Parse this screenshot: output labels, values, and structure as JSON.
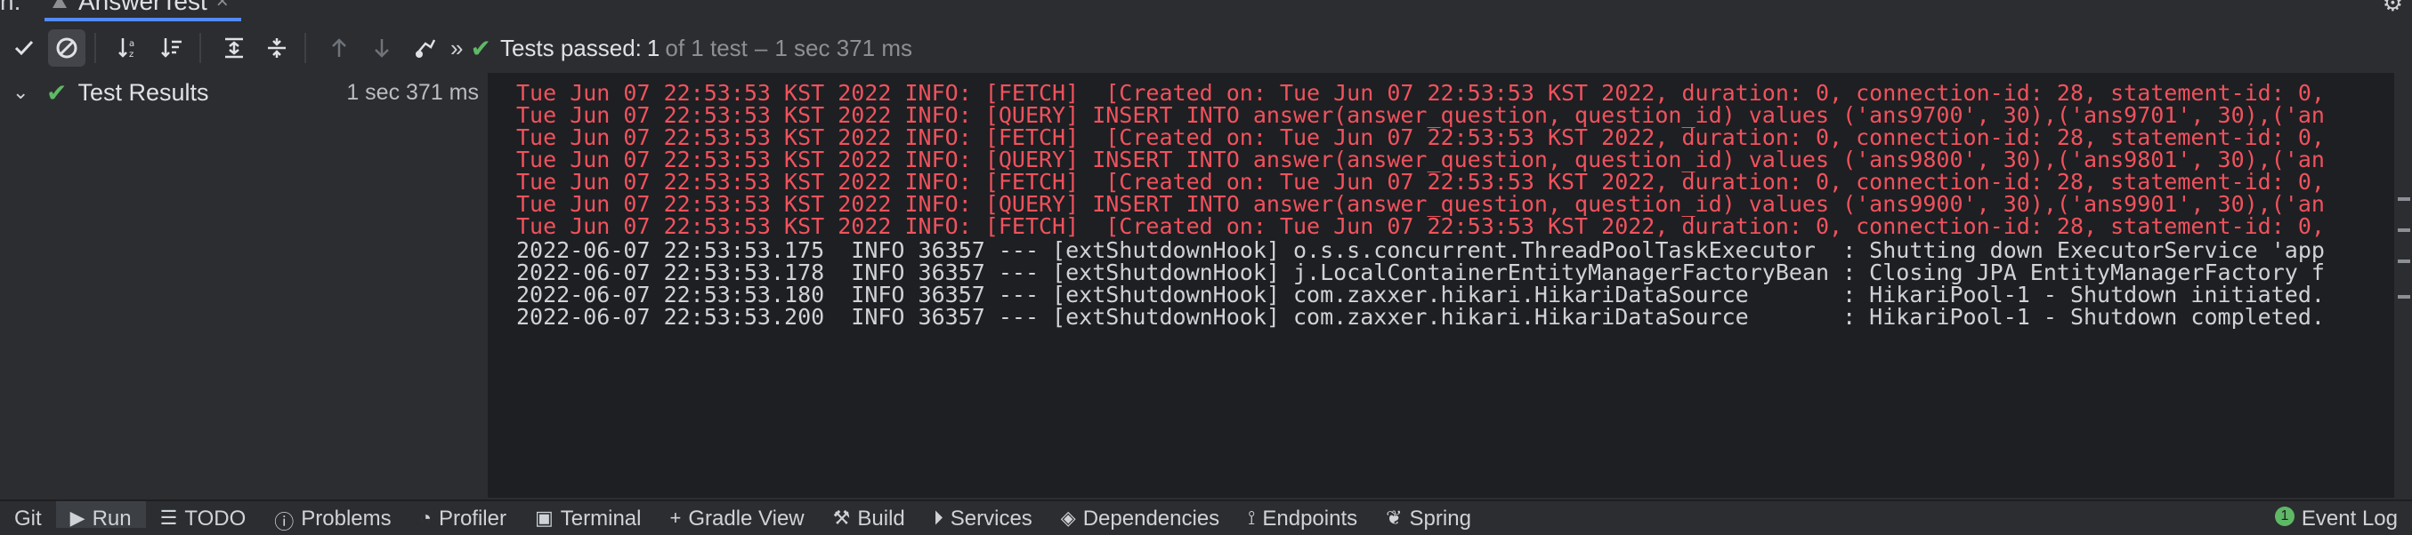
{
  "tab": {
    "left_letter": "n:",
    "title": "AnswerTest",
    "close": "×"
  },
  "toolbar": {
    "chevrons": "»",
    "status_label": "Tests passed:",
    "passed_count": "1",
    "of_text": "of 1 test",
    "dash": "–",
    "duration": "1 sec 371 ms"
  },
  "tree": {
    "chevron": "⌄",
    "root_label": "Test Results",
    "root_duration": "1 sec 371 ms"
  },
  "console": {
    "lines": [
      {
        "kind": "err",
        "text": "Tue Jun 07 22:53:53 KST 2022 INFO: [FETCH]  [Created on: Tue Jun 07 22:53:53 KST 2022, duration: 0, connection-id: 28, statement-id: 0,"
      },
      {
        "kind": "err",
        "text": "Tue Jun 07 22:53:53 KST 2022 INFO: [QUERY] INSERT INTO answer(answer_question, question_id) values ('ans9700', 30),('ans9701', 30),('an"
      },
      {
        "kind": "err",
        "text": "Tue Jun 07 22:53:53 KST 2022 INFO: [FETCH]  [Created on: Tue Jun 07 22:53:53 KST 2022, duration: 0, connection-id: 28, statement-id: 0,"
      },
      {
        "kind": "err",
        "text": "Tue Jun 07 22:53:53 KST 2022 INFO: [QUERY] INSERT INTO answer(answer_question, question_id) values ('ans9800', 30),('ans9801', 30),('an"
      },
      {
        "kind": "err",
        "text": "Tue Jun 07 22:53:53 KST 2022 INFO: [FETCH]  [Created on: Tue Jun 07 22:53:53 KST 2022, duration: 0, connection-id: 28, statement-id: 0,"
      },
      {
        "kind": "err",
        "text": "Tue Jun 07 22:53:53 KST 2022 INFO: [QUERY] INSERT INTO answer(answer_question, question_id) values ('ans9900', 30),('ans9901', 30),('an"
      },
      {
        "kind": "err",
        "text": "Tue Jun 07 22:53:53 KST 2022 INFO: [FETCH]  [Created on: Tue Jun 07 22:53:53 KST 2022, duration: 0, connection-id: 28, statement-id: 0,"
      },
      {
        "kind": "info",
        "text": "2022-06-07 22:53:53.175  INFO 36357 --- [extShutdownHook] o.s.s.concurrent.ThreadPoolTaskExecutor  : Shutting down ExecutorService 'app"
      },
      {
        "kind": "info",
        "text": "2022-06-07 22:53:53.178  INFO 36357 --- [extShutdownHook] j.LocalContainerEntityManagerFactoryBean : Closing JPA EntityManagerFactory f"
      },
      {
        "kind": "info",
        "text": "2022-06-07 22:53:53.180  INFO 36357 --- [extShutdownHook] com.zaxxer.hikari.HikariDataSource       : HikariPool-1 - Shutdown initiated."
      },
      {
        "kind": "info",
        "text": "2022-06-07 22:53:53.200  INFO 36357 --- [extShutdownHook] com.zaxxer.hikari.HikariDataSource       : HikariPool-1 - Shutdown completed."
      }
    ]
  },
  "bottombar": {
    "items": [
      {
        "label": "Git",
        "icon": ""
      },
      {
        "label": "Run",
        "icon": "▶"
      },
      {
        "label": "TODO",
        "icon": "☰"
      },
      {
        "label": "Problems",
        "icon": "ⓘ"
      },
      {
        "label": "Profiler",
        "icon": "◔"
      },
      {
        "label": "Terminal",
        "icon": "▣"
      },
      {
        "label": "Gradle View",
        "icon": "+"
      },
      {
        "label": "Build",
        "icon": "⚒"
      },
      {
        "label": "Services",
        "icon": "⏵"
      },
      {
        "label": "Dependencies",
        "icon": "◈"
      },
      {
        "label": "Endpoints",
        "icon": "⟟"
      },
      {
        "label": "Spring",
        "icon": "❦"
      }
    ],
    "event_log": "Event Log",
    "event_badge": "1"
  },
  "colors": {
    "pass_green": "#5fb865",
    "error_red": "#f0525d",
    "accent_blue": "#548af7"
  }
}
